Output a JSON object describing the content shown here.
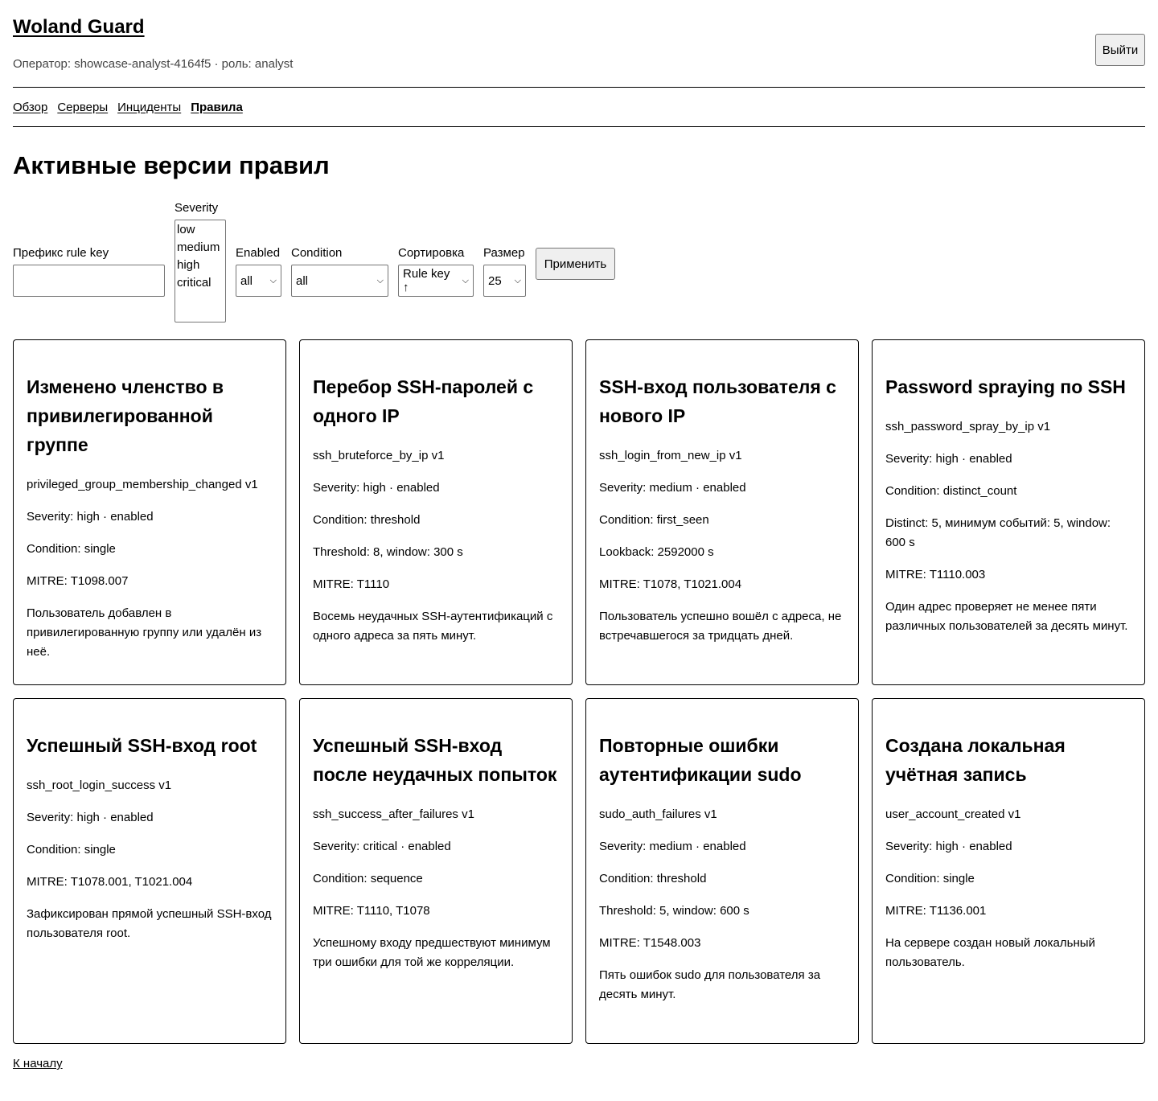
{
  "header": {
    "brand": "Woland Guard",
    "operator": "Оператор: showcase-analyst-4164f5 · роль: analyst",
    "logout_label": "Выйти"
  },
  "nav": {
    "items": [
      {
        "label": "Обзор",
        "active": false
      },
      {
        "label": "Серверы",
        "active": false
      },
      {
        "label": "Инциденты",
        "active": false
      },
      {
        "label": "Правила",
        "active": true
      }
    ]
  },
  "page_title": "Активные версии правил",
  "filters": {
    "prefix_label": "Префикс rule key",
    "prefix_value": "",
    "severity_label": "Severity",
    "severity_options": [
      "low",
      "medium",
      "high",
      "critical"
    ],
    "enabled_label": "Enabled",
    "enabled_value": "all",
    "condition_label": "Condition",
    "condition_value": "all",
    "sort_label": "Сортировка",
    "sort_value": "Rule key ↑",
    "size_label": "Размер",
    "size_value": "25",
    "apply_label": "Применить"
  },
  "rules": [
    {
      "title": "Изменено членство в привилегированной группе",
      "key": "privileged_group_membership_changed v1",
      "severity": "Severity: high · enabled",
      "condition": "Condition: single",
      "params": "",
      "mitre": "MITRE: T1098.007",
      "description": "Пользователь добавлен в привилегированную группу или удалён из неё."
    },
    {
      "title": "Перебор SSH-паролей с одного IP",
      "key": "ssh_bruteforce_by_ip v1",
      "severity": "Severity: high · enabled",
      "condition": "Condition: threshold",
      "params": "Threshold: 8, window: 300 s",
      "mitre": "MITRE: T1110",
      "description": "Восемь неудачных SSH-аутентификаций с одного адреса за пять минут."
    },
    {
      "title": "SSH-вход пользователя с нового IP",
      "key": "ssh_login_from_new_ip v1",
      "severity": "Severity: medium · enabled",
      "condition": "Condition: first_seen",
      "params": "Lookback: 2592000 s",
      "mitre": "MITRE: T1078, T1021.004",
      "description": "Пользователь успешно вошёл с адреса, не встречавшегося за тридцать дней."
    },
    {
      "title": "Password spraying по SSH",
      "key": "ssh_password_spray_by_ip v1",
      "severity": "Severity: high · enabled",
      "condition": "Condition: distinct_count",
      "params": "Distinct: 5, минимум событий: 5, window: 600 s",
      "mitre": "MITRE: T1110.003",
      "description": "Один адрес проверяет не менее пяти различных пользователей за десять минут."
    },
    {
      "title": "Успешный SSH-вход root",
      "key": "ssh_root_login_success v1",
      "severity": "Severity: high · enabled",
      "condition": "Condition: single",
      "params": "",
      "mitre": "MITRE: T1078.001, T1021.004",
      "description": "Зафиксирован прямой успешный SSH-вход пользователя root."
    },
    {
      "title": "Успешный SSH-вход после неудачных попыток",
      "key": "ssh_success_after_failures v1",
      "severity": "Severity: critical · enabled",
      "condition": "Condition: sequence",
      "params": "",
      "mitre": "MITRE: T1110, T1078",
      "description": "Успешному входу предшествуют минимум три ошибки для той же корреляции."
    },
    {
      "title": "Повторные ошибки аутентификации sudo",
      "key": "sudo_auth_failures v1",
      "severity": "Severity: medium · enabled",
      "condition": "Condition: threshold",
      "params": "Threshold: 5, window: 600 s",
      "mitre": "MITRE: T1548.003",
      "description": "Пять ошибок sudo для пользователя за десять минут."
    },
    {
      "title": "Создана локальная учётная запись",
      "key": "user_account_created v1",
      "severity": "Severity: high · enabled",
      "condition": "Condition: single",
      "params": "",
      "mitre": "MITRE: T1136.001",
      "description": "На сервере создан новый локальный пользователь."
    }
  ],
  "footer": {
    "back_label": "К началу"
  },
  "icons": {
    "dropdown": "chevron-down-icon"
  }
}
